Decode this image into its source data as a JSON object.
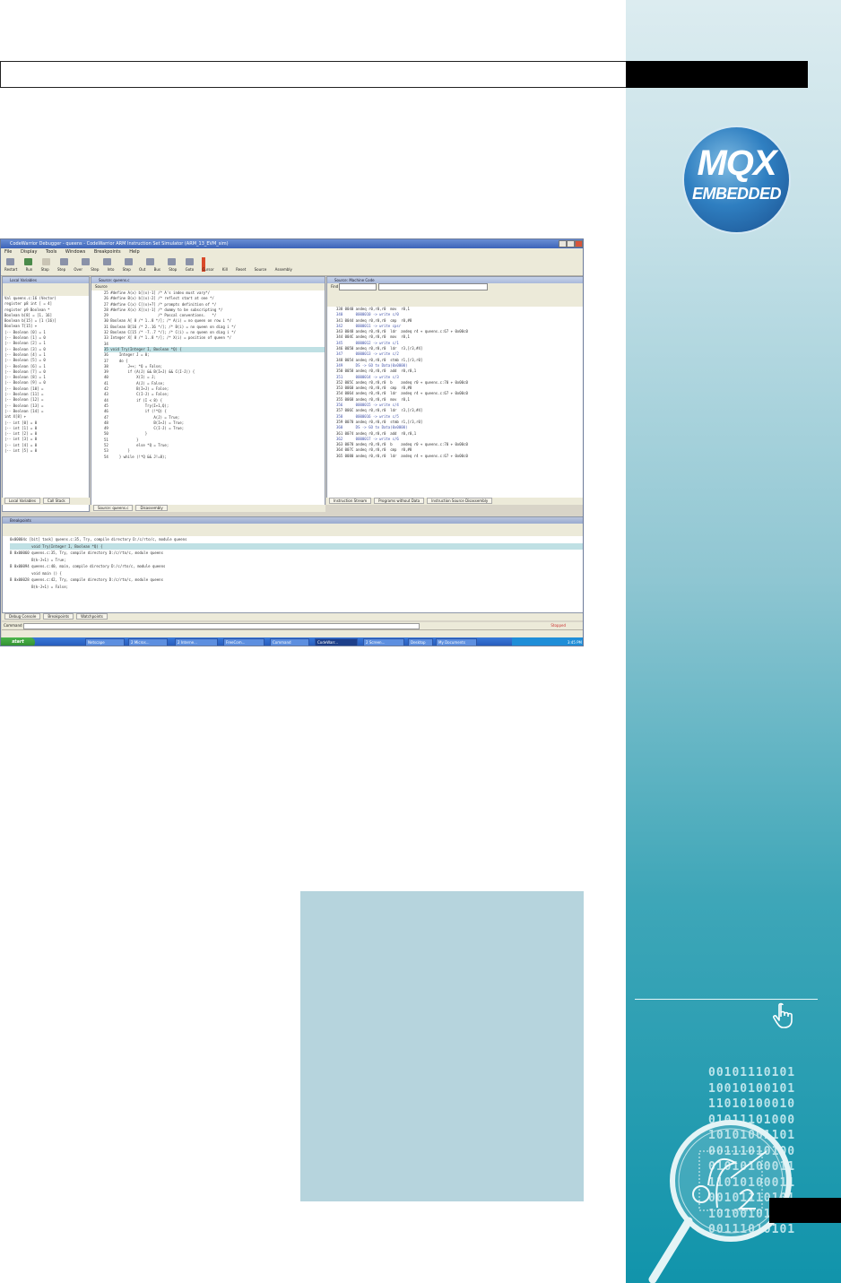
{
  "sidebar": {
    "logo": {
      "line1": "MQX",
      "line2": "EMBEDDED"
    },
    "binary_lines": [
      "00101110101",
      "10010100101",
      "11010100010",
      "01011101000",
      "10101001101",
      "00111010100",
      "01010100011",
      "11010100011",
      "00101110101",
      "10100101001",
      "00111010101"
    ]
  },
  "window": {
    "title": "CodeWarrior Debugger - queens - CodeWarrior ARM Instruction Set Simulator (ARM_13_EVM_sim)",
    "menu": [
      "File",
      "Display",
      "Tools",
      "Windows",
      "Breakpoints",
      "Help"
    ],
    "toolbar": [
      "Restart",
      "Run",
      "Stop",
      "Step Over",
      "Step Into",
      "Step Out",
      "Bus Stop",
      "Goto Cursor",
      "Kill",
      "Reset",
      "Source",
      "Assembly"
    ],
    "local_variables_title": "Local Variables",
    "source_title": "Source: queens.c",
    "disasm_title": "Source: Machine Code",
    "breakpoints_title": "Breakpoints",
    "find_label": "Find",
    "source_label": "Source",
    "local_tabs": [
      "Local Variables",
      "Call Stack"
    ],
    "source_tabs": [
      "Source: queens.c",
      "Disassembly"
    ],
    "disasm_tabs": [
      "Instruction Stream",
      "Programs without Data",
      "Instruction Source Disassembly"
    ],
    "bottom_tabs": [
      "Debug Console",
      "Breakpoints",
      "Watchpoints"
    ],
    "command_label": "Command",
    "status_right": "Stopped",
    "start_label": "start",
    "tasks": [
      "Netscape",
      "2 Micros...",
      "2 Interne...",
      "FreeCom...",
      "Command",
      "CodeWarr...",
      "2 Screen...",
      "Desktop",
      "My Documents"
    ],
    "clock": "3:45 PM",
    "vars": [
      "Val queens.c:16 (Vector)",
      "register p8 int [ = 4]",
      "register p9 Boolean *",
      "Boolean b[8] = [1, 16]",
      "Boolean b[15] = [1 (16)]",
      "Boolean T[15] +",
      "|-- Boolean [0] = 1",
      "|-- Boolean [1] = 0",
      "|-- Boolean [2] = 1",
      "|-- Boolean [3] = 0",
      "|-- Boolean [4] = 1",
      "|-- Boolean [5] = 0",
      "|-- Boolean [6] = 1",
      "|-- Boolean [7] = 0",
      "|-- Boolean [8] = 1",
      "|-- Boolean [9] = 0",
      "|-- Boolean [10] =",
      "|-- Boolean [11] =",
      "|-- Boolean [12] =",
      "|-- Boolean [13] =",
      "|-- Boolean [14] =",
      "int X[8] +",
      "|-- int [0] = 0",
      "|-- int [1] = 0",
      "|-- int [2] = 0",
      "|-- int [3] = 0",
      "|-- int [4] = 0",
      "|-- int [5] = 0"
    ],
    "source_lines": [
      "25 #define A(x) b[(x)-1] /* A's index must vary*/",
      "26 #define B(x) b[(x)-2] /* reflect start at one */",
      "27 #define C(x) C[(x)+7] /* prompts definition of */",
      "28 #define X(x) X[(x)-1] /* dummy to be subscripting */",
      "29                       /* Pascal conventions.   */",
      "30 Boolean A[ 8 /* 1..8 */]; /* A(i) = no queen on row i */",
      "31 Boolean B[16 /* 2..16 */]; /* B(i) = no queen on diag i */",
      "32 Boolean C[15 /* -7..7 */]; /* C(i) = no queen on diag i */",
      "33 Integer X[ 8 /* 1..8 */]; /* X(i) = position of queen */",
      "34",
      "35 void Try(Integer I, Boolean *Q) {",
      "36     Integer J = 0;",
      "37     do {",
      "38         J++; *Q = False;",
      "39         if (A(J) && B(I+J) && C(I-J)) {",
      "40             X(I) = J;",
      "41             A(J) = False;",
      "42             B(I+J) = False;",
      "43             C(I-J) = False;",
      "44             if (I < 8) {",
      "45                 Try(I+1,Q);",
      "46                 if (!*Q) {",
      "47                     A(J) = True;",
      "48                     B(I+J) = True;",
      "49                     C(I-J) = True;",
      "50                 }",
      "51             }",
      "52             else *Q = True;",
      "53         }",
      "54     } while (!*Q && J!=8);"
    ],
    "disasm_lines": [
      "338 0040 andeq r0,r0,r0  mov  r0,1",
      "340      0000010 -> write c/0",
      "341 0044 andeq r0,r0,r0  cmp  r0,#8",
      "342      0000011 -> write cpsr",
      "343 0048 andeq r0,r0,r0  ldr  andeq r4 + queens.c:67 + 0x00c0",
      "344 004C andeq r0,r0,r0  mov  r0,1",
      "345      0000012 -> write c/1",
      "346 0050 andeq r0,r0,r0  ldr  r3,[r3,#4]",
      "347      0000013 -> write c/2",
      "348 0054 andeq r0,r0,r0  stmb r1,[r3,r0]",
      "349      DS -> GO to Data(0x0000)",
      "350 0058 andeq r0,r0,r0  add  r0,r0,1",
      "351      0000014 -> write c/3",
      "352 005C andeq r0,r0,r0  b    andeq r0 + queens.c:70 + 0x00c0",
      "353 0060 andeq r0,r0,r0  cmp  r0,#8",
      "354 0064 andeq r0,r0,r0  ldr  andeq r4 + queens.c:67 + 0x00c0",
      "355 0068 andeq r0,r0,r0  mov  r0,1",
      "356      0000015 -> write c/4",
      "357 006C andeq r0,r0,r0  ldr  r3,[r3,#4]",
      "358      0000016 -> write c/5",
      "359 0070 andeq r0,r0,r0  stmb r1,[r3,r0]",
      "360      DS -> GO to Data(0x0000)",
      "361 0074 andeq r0,r0,r0  add  r0,r0,1",
      "362      0000017 -> write c/6",
      "363 0078 andeq r0,r0,r0  b    andeq r0 + queens.c:70 + 0x00c0",
      "364 007C andeq r0,r0,r0  cmp  r0,#8",
      "365 0080 andeq r0,r0,r0  ldr  andeq r4 + queens.c:67 + 0x00c0"
    ],
    "breakpoint_lines": [
      "0x00004c [bit] task] queens.c:35, Try, compile directory D:/c/rto/c, module queens",
      "          void Try(Integer I, Boolean *Q) {",
      "B 0x00060 queens.c:35, Try, compile directory D:/c/rto/c, module queens",
      "          B(k-J+1) = True;",
      "B 0x00094 queens.c:40, main, compile directory D:/c/rto/c, module queens",
      "          void main () {",
      "B 0x00028 queens.c:42, Try, compile directory D:/c/rto/c, module queens",
      "          B(k-J+1) = False;"
    ]
  }
}
